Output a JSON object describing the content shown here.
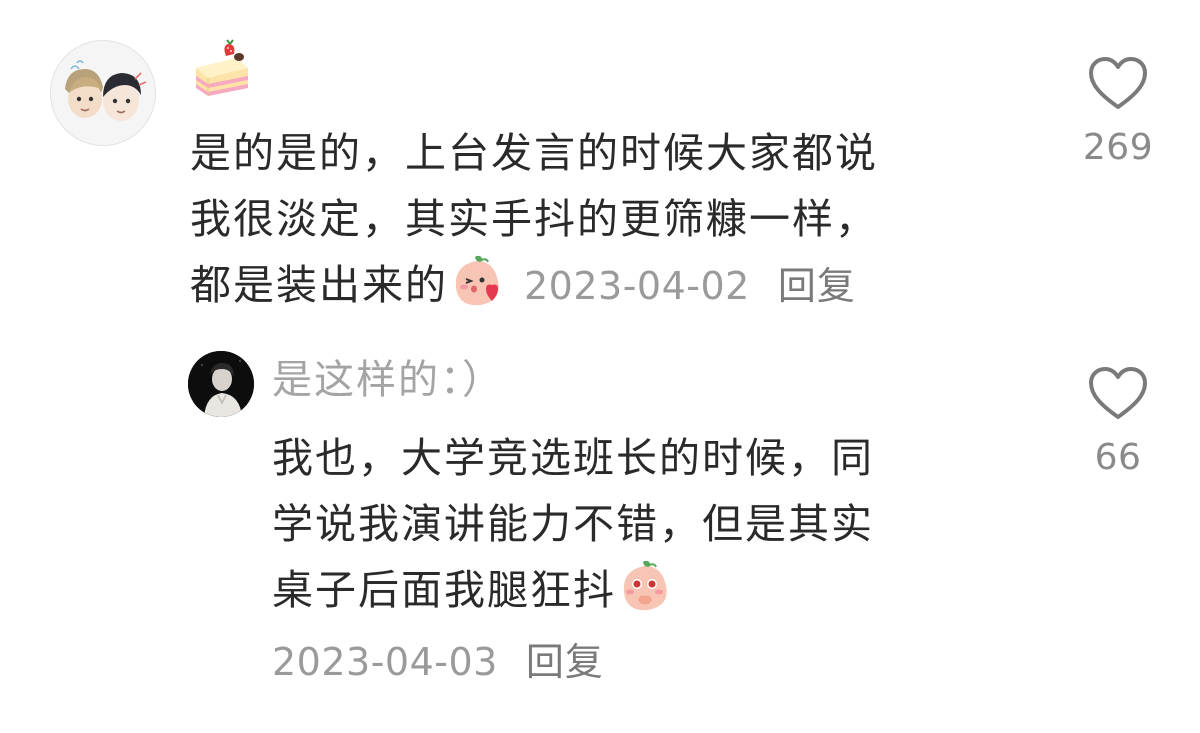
{
  "comments": [
    {
      "avatar_icon": "couple-cartoon-avatar-icon",
      "name_sticker": "strawberry-cake-icon",
      "lines": [
        "是的是的，上台发言的时候大家都说",
        "我很淡定，其实手抖的更筛糠一样，",
        "都是装出来的"
      ],
      "trailing_emoji": "peach-kiss-heart-emoji-icon",
      "date": "2023-04-02",
      "reply_label": "回复",
      "like_count": "269"
    },
    {
      "avatar_icon": "dark-portrait-avatar-icon",
      "username": "是这样的：）",
      "lines": [
        "我也，大学竞选班长的时候，同",
        "学说我演讲能力不错，但是其实",
        "桌子后面我腿狂抖"
      ],
      "trailing_emoji": "peach-shy-emoji-icon",
      "date": "2023-04-03",
      "reply_label": "回复",
      "like_count": "66"
    }
  ],
  "colors": {
    "text": "#2a2a2a",
    "meta": "#9a9a9a",
    "username": "#a4a4a4",
    "like_count": "#8a8a8a"
  }
}
